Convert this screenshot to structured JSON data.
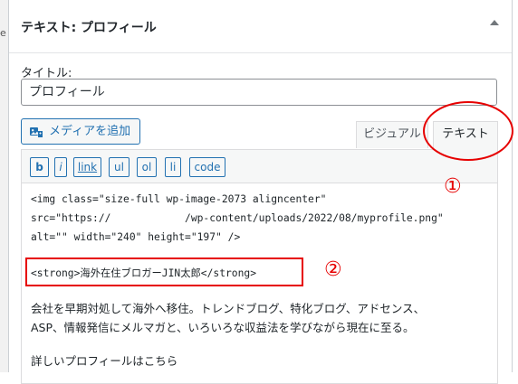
{
  "sidebar_edge": {
    "letter": "e"
  },
  "widget": {
    "title": "テキスト: プロフィール",
    "toggle_icon": "triangle-up-icon"
  },
  "form": {
    "title_label": "タイトル:",
    "title_value": "プロフィール"
  },
  "toolbar": {
    "media_button_label": "メディアを追加",
    "media_icon": "media-add-icon",
    "tab_visual": "ビジュアル",
    "tab_text": "テキスト",
    "active_tab": "テキスト"
  },
  "quicktags": {
    "b": "b",
    "i": "i",
    "link": "link",
    "ul": "ul",
    "ol": "ol",
    "li": "li",
    "code": "code"
  },
  "editor": {
    "line1": "<img class=\"size-full wp-image-2073 aligncenter\"",
    "line2": "src=\"https://            /wp-content/uploads/2022/08/myprofile.png\"",
    "line3": "alt=\"\" width=\"240\" height=\"197\" />",
    "line4": "<strong>海外在住ブロガーJIN太郎</strong>",
    "line5": "会社を早期対処して海外へ移住。トレンドブログ、特化ブログ、アドセンス、",
    "line6": "ASP、情報発信にメルマガと、いろいろな収益法を学びながら現在に至る。",
    "line7": "詳しいプロフィールはこちら"
  },
  "annotations": {
    "mark1": "①",
    "mark2": "②",
    "color": "#e60000"
  }
}
